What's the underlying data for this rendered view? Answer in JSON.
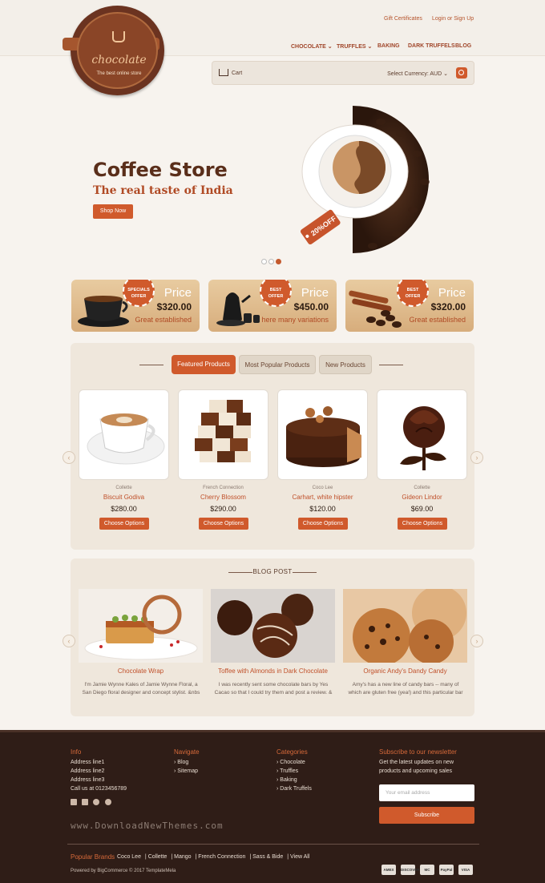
{
  "header": {
    "top_links": [
      "Gift Certificates",
      "Login or Sign Up"
    ],
    "nav": [
      {
        "label": "CHOCOLATE",
        "dropdown": true
      },
      {
        "label": "TRUFFLES",
        "dropdown": true
      },
      {
        "label": "BAKING",
        "dropdown": false
      },
      {
        "label": "DARK TRUFFELS",
        "dropdown": false
      },
      {
        "label": "BLOG",
        "dropdown": false
      }
    ],
    "logo": {
      "name": "chocolate",
      "tagline": "The best online store"
    },
    "cart_label": "Cart",
    "currency_label": "Select Currency: AUD",
    "chevron": "⌄"
  },
  "hero": {
    "title": "Coffee Store",
    "subtitle": "The real taste of India",
    "button": "Shop Now",
    "tag": "20%OFF",
    "slides": 3,
    "active_slide": 3
  },
  "offers": [
    {
      "badge_top": "SPECIALS",
      "badge_bottom": "OFFER",
      "price_label": "Price",
      "price": "$320.00",
      "caption": "Great established"
    },
    {
      "badge_top": "BEST",
      "badge_bottom": "OFFER",
      "price_label": "Price",
      "price": "$450.00",
      "caption": "here many variations"
    },
    {
      "badge_top": "BEST",
      "badge_bottom": "OFFER",
      "price_label": "Price",
      "price": "$320.00",
      "caption": "Great established"
    }
  ],
  "product_tabs": [
    "Featured Products",
    "Most Popular Products",
    "New Products"
  ],
  "products": [
    {
      "brand": "Collette",
      "name": "Biscuit Godiva",
      "price": "$280.00",
      "button": "Choose Options"
    },
    {
      "brand": "French Connection",
      "name": "Cherry Blossom",
      "price": "$290.00",
      "button": "Choose Options"
    },
    {
      "brand": "Coco Lee",
      "name": "Carhart, white hipster",
      "price": "$120.00",
      "button": "Choose Options"
    },
    {
      "brand": "Collette",
      "name": "Gideon Lindor",
      "price": "$69.00",
      "button": "Choose Options"
    }
  ],
  "arrows": {
    "left": "‹",
    "right": "›"
  },
  "blog": {
    "title": "BLOG POST",
    "posts": [
      {
        "title": "Chocolate Wrap",
        "excerpt_1": "I'm Jamie Wynne Kales of Jamie Wynne Floral, a",
        "excerpt_2": "San Diego floral designer and concept stylist. &nbs"
      },
      {
        "title": "Toffee with Almonds in Dark Chocolate",
        "excerpt_1": "I was recently sent some chocolate bars by Yes",
        "excerpt_2": "Cacao so that I could try them and post a review. &"
      },
      {
        "title": "Organic Andy's Dandy Candy",
        "excerpt_1": "Amy's has a new line of candy bars -- many of",
        "excerpt_2": "which are gluten free (yea!) and this particular bar"
      }
    ]
  },
  "footer": {
    "info": {
      "title": "Info",
      "lines": [
        "Address line1",
        "Address line2",
        "Address line3",
        "Call us at 0123456789"
      ]
    },
    "navigate": {
      "title": "Navigate",
      "items": [
        "Blog",
        "Sitemap"
      ]
    },
    "categories": {
      "title": "Categories",
      "items": [
        "Chocolate",
        "Truffles",
        "Baking",
        "Dark Truffels"
      ]
    },
    "newsletter": {
      "title": "Subscribe to our newsletter",
      "text_1": "Get the latest updates on new",
      "text_2": "products and upcoming sales",
      "placeholder": "Your email address",
      "button": "Subscribe"
    },
    "watermark": "www.DownloadNewThemes.com",
    "brands_title": "Popular Brands",
    "brands": [
      "Coco Lee",
      "Collette",
      "Mango",
      "French Connection",
      "Sass & Bide",
      "View All"
    ],
    "powered": "Powered by BigCommerce  © 2017 TemplateMela",
    "payments": [
      "AMEX",
      "DISCOVER",
      "MC",
      "PayPal",
      "VISA"
    ],
    "bullet": "›"
  }
}
